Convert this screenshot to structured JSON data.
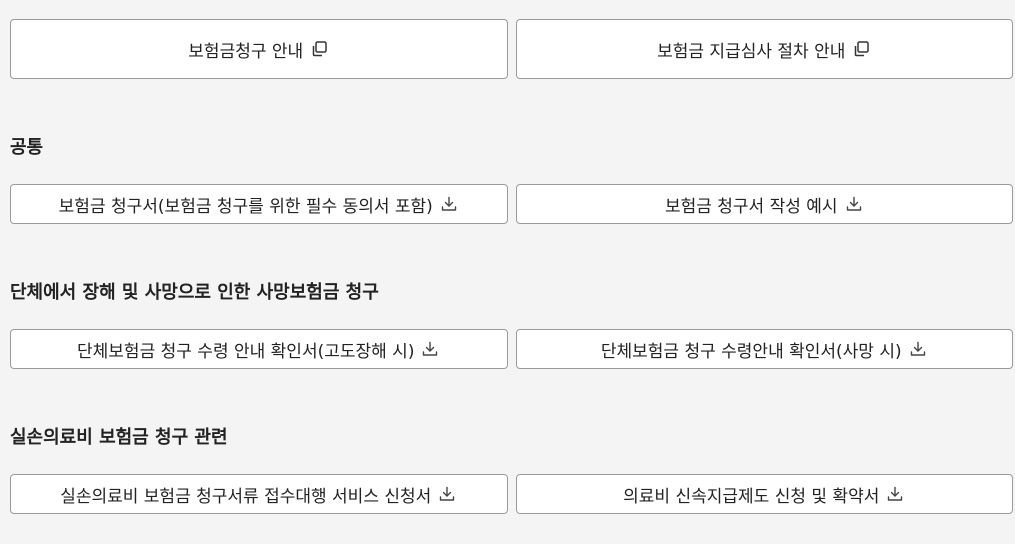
{
  "guide": {
    "items": [
      {
        "label": "보험금청구 안내",
        "icon": "copy-icon"
      },
      {
        "label": "보험금 지급심사 절차 안내",
        "icon": "copy-icon"
      }
    ]
  },
  "sections": [
    {
      "title": "공통",
      "items": [
        {
          "label": "보험금 청구서(보험금 청구를 위한 필수 동의서 포함)",
          "icon": "download-icon"
        },
        {
          "label": "보험금 청구서 작성 예시",
          "icon": "download-icon"
        }
      ]
    },
    {
      "title": "단체에서 장해 및 사망으로 인한 사망보험금 청구",
      "items": [
        {
          "label": "단체보험금 청구 수령 안내 확인서(고도장해 시)",
          "icon": "download-icon"
        },
        {
          "label": "단체보험금 청구 수령안내 확인서(사망 시)",
          "icon": "download-icon"
        }
      ]
    },
    {
      "title": "실손의료비 보험금 청구 관련",
      "items": [
        {
          "label": "실손의료비 보험금 청구서류 접수대행 서비스 신청서",
          "icon": "download-icon"
        },
        {
          "label": "의료비 신속지급제도 신청 및 확약서",
          "icon": "download-icon"
        }
      ]
    }
  ]
}
